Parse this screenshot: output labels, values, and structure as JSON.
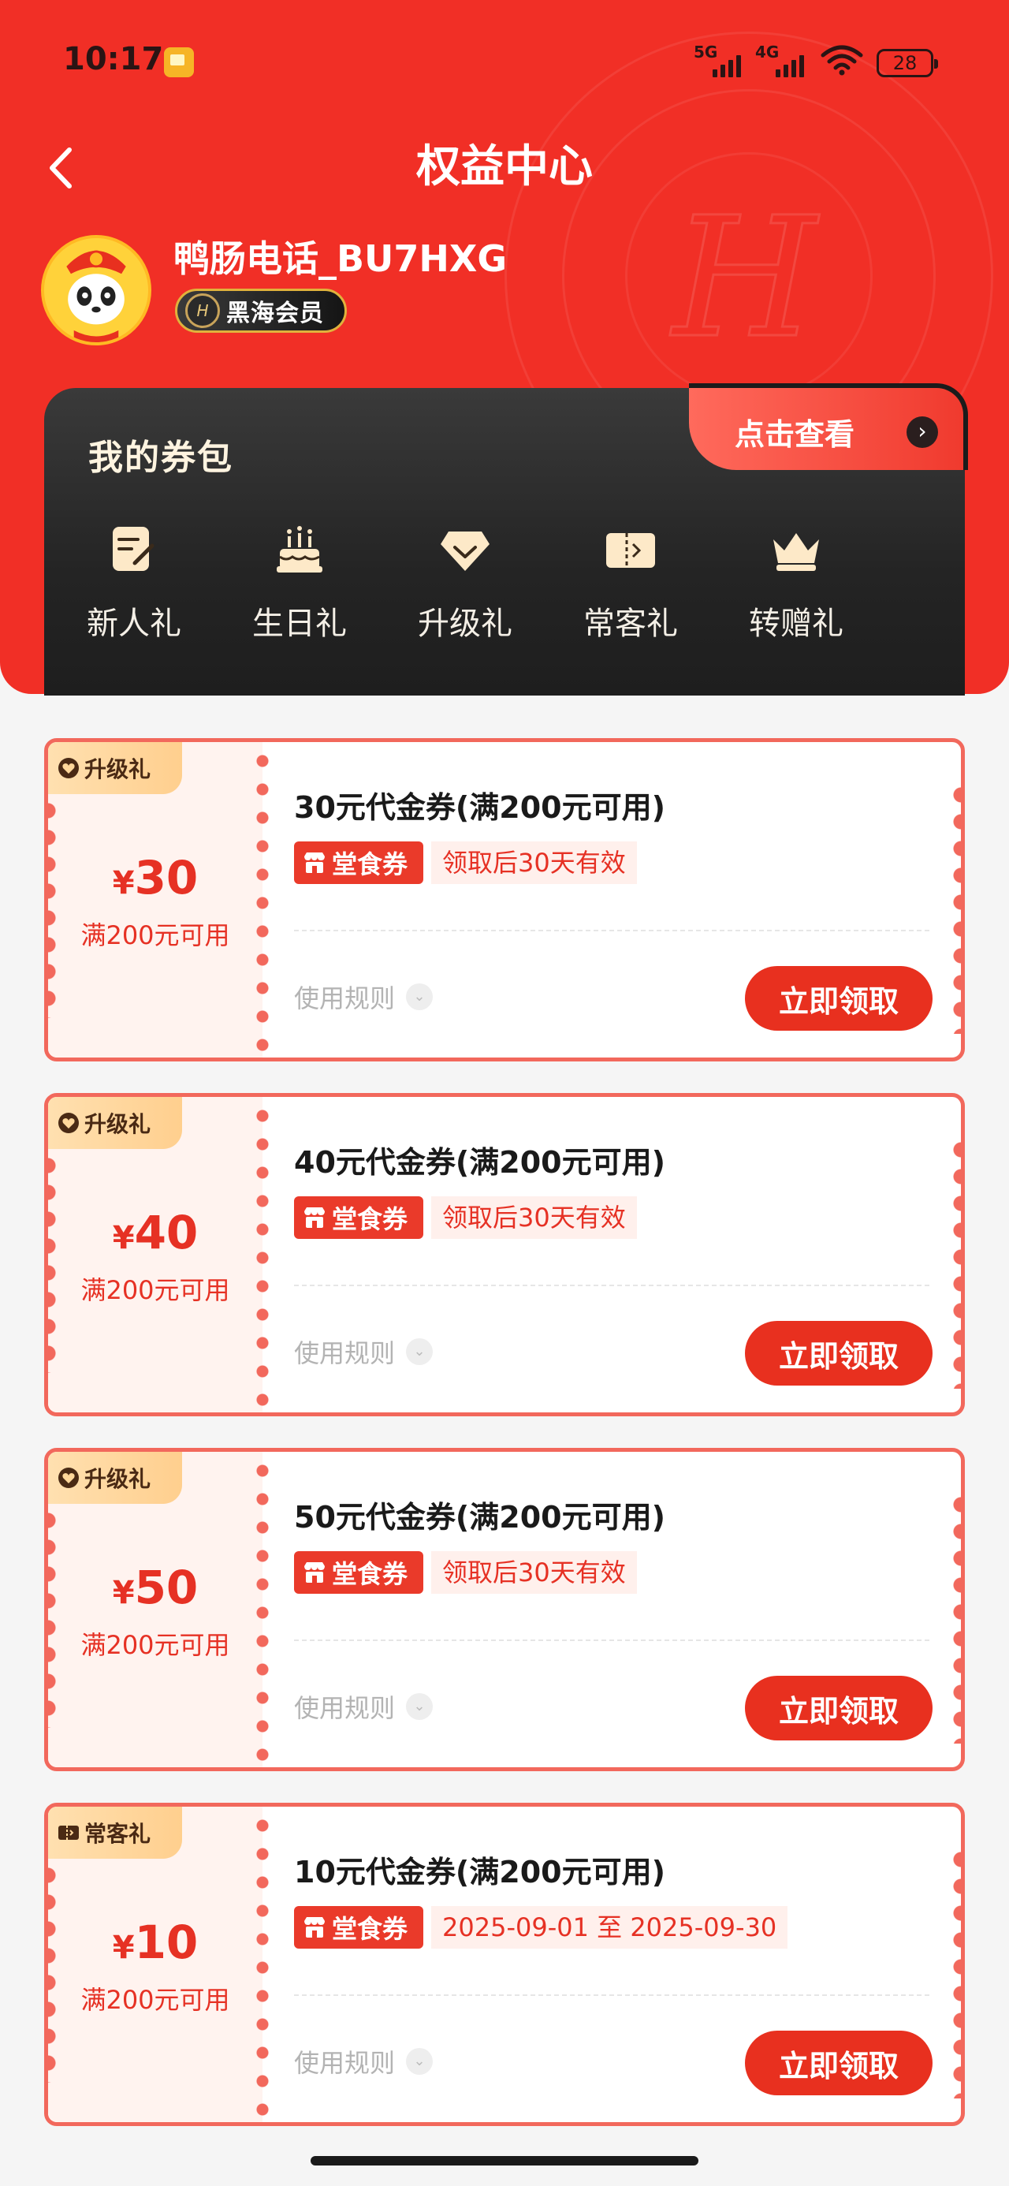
{
  "status_bar": {
    "time": "10:17",
    "network_1": "5G",
    "network_2": "4G",
    "battery": "28"
  },
  "header": {
    "title": "权益中心",
    "username": "鸭肠电话_BU7HXG",
    "member_level": "黑海会员"
  },
  "wallet": {
    "title": "我的券包",
    "view_link": "点击查看",
    "gifts": [
      {
        "label": "新人礼",
        "icon": "pencil-note-icon"
      },
      {
        "label": "生日礼",
        "icon": "cake-icon"
      },
      {
        "label": "升级礼",
        "icon": "diamond-icon"
      },
      {
        "label": "常客礼",
        "icon": "ticket-icon"
      },
      {
        "label": "转赠礼",
        "icon": "crown-icon"
      }
    ]
  },
  "coupons": [
    {
      "tag": "升级礼",
      "tag_icon": "heart-icon",
      "currency": "¥",
      "amount": "30",
      "min_spend": "满200元可用",
      "title": "30元代金券(满200元可用)",
      "type": "堂食券",
      "validity": "领取后30天有效",
      "rules": "使用规则",
      "claim": "立即领取"
    },
    {
      "tag": "升级礼",
      "tag_icon": "heart-icon",
      "currency": "¥",
      "amount": "40",
      "min_spend": "满200元可用",
      "title": "40元代金券(满200元可用)",
      "type": "堂食券",
      "validity": "领取后30天有效",
      "rules": "使用规则",
      "claim": "立即领取"
    },
    {
      "tag": "升级礼",
      "tag_icon": "heart-icon",
      "currency": "¥",
      "amount": "50",
      "min_spend": "满200元可用",
      "title": "50元代金券(满200元可用)",
      "type": "堂食券",
      "validity": "领取后30天有效",
      "rules": "使用规则",
      "claim": "立即领取"
    },
    {
      "tag": "常客礼",
      "tag_icon": "ticket-icon",
      "currency": "¥",
      "amount": "10",
      "min_spend": "满200元可用",
      "title": "10元代金券(满200元可用)",
      "type": "堂食券",
      "validity": "2025-09-01 至 2025-09-30",
      "rules": "使用规则",
      "claim": "立即领取"
    }
  ],
  "colors": {
    "brand_red": "#f12f26",
    "coupon_border": "#f2685c",
    "button_red": "#e8301f",
    "wallet_dark": "#242424",
    "badge_gold": "#e0b23c"
  }
}
